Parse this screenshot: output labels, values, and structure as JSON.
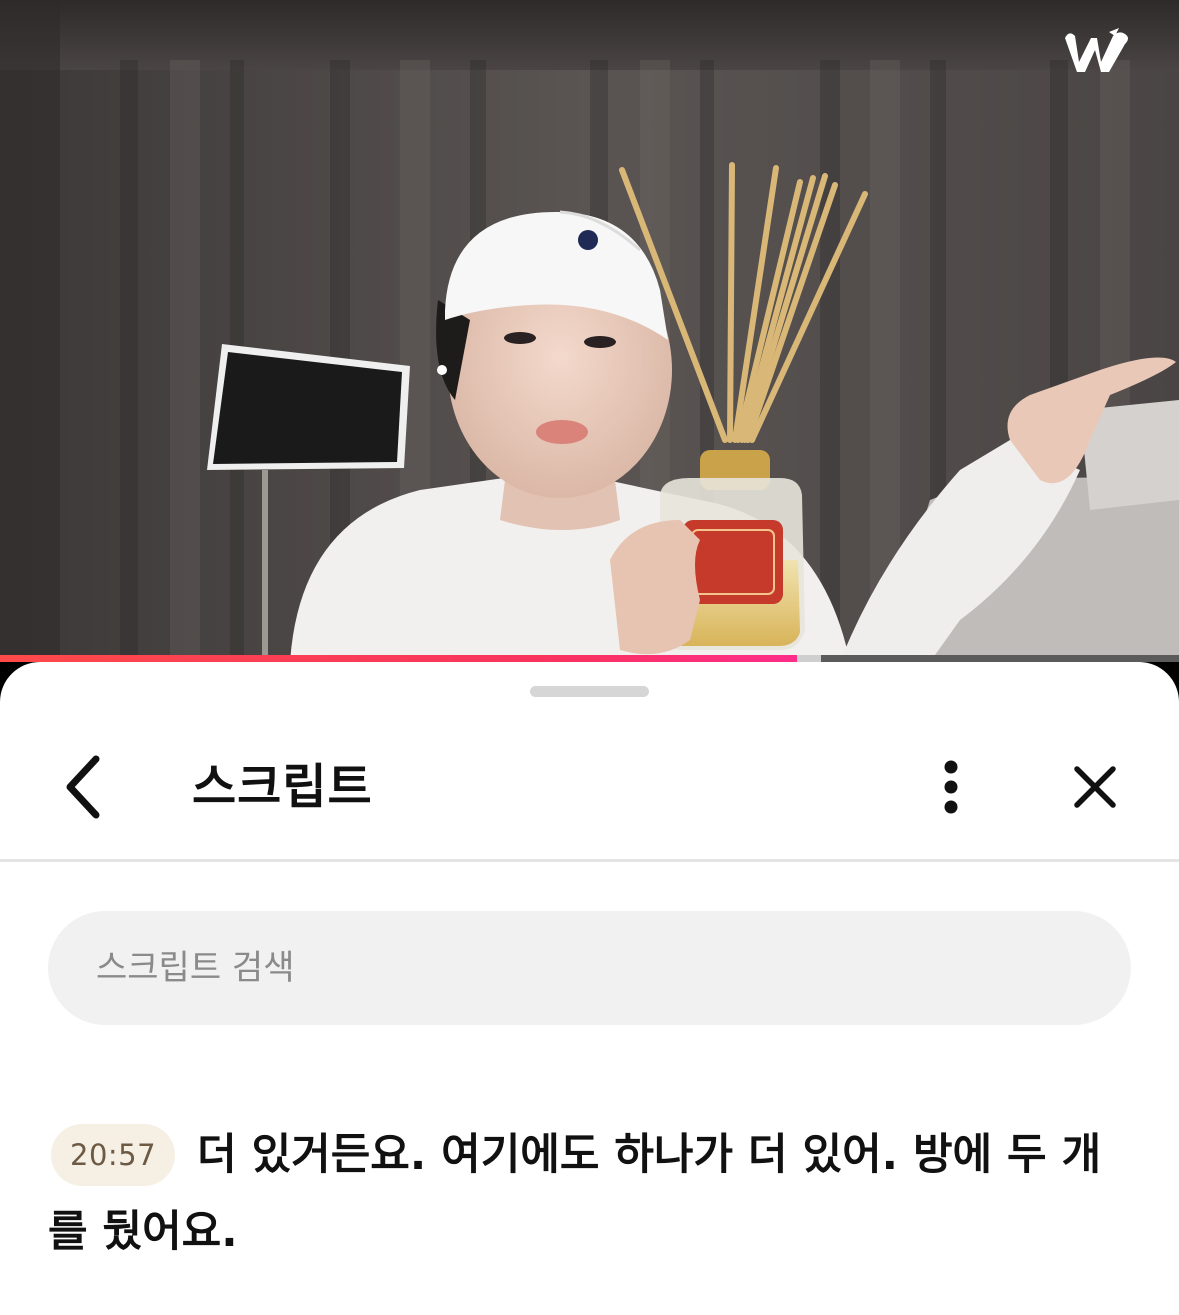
{
  "video": {
    "brand_logo": "w",
    "progress_played": 0.676,
    "progress_buffered": 0.696
  },
  "sheet": {
    "header": {
      "back_icon": "chevron-left-icon",
      "title": "스크립트",
      "more_icon": "vertical-dots-icon",
      "close_icon": "close-icon"
    },
    "search": {
      "placeholder": "스크립트 검색",
      "value": ""
    },
    "entries": [
      {
        "timestamp": "20:57",
        "text": "더 있거든요. 여기에도 하나가 더 있어. 방에 두 개를 뒀어요."
      }
    ]
  },
  "colors": {
    "progress_red": "#f8335f",
    "timestamp_bg": "#f6efe4",
    "timestamp_text": "#6d5a44",
    "search_bg": "#f1f1f1"
  }
}
